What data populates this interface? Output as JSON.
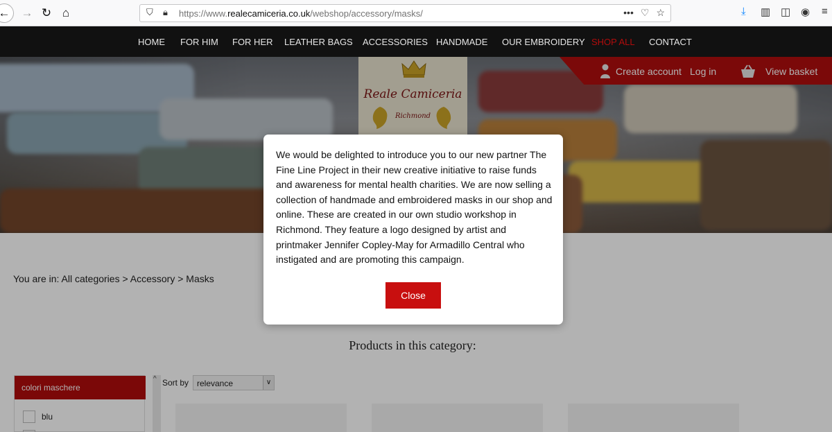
{
  "browser": {
    "url_prefix": "https://www.",
    "url_domain": "realecamiceria.co.uk",
    "url_path": "/webshop/accessory/masks/",
    "more_label": "•••"
  },
  "nav": {
    "items": [
      "HOME",
      "FOR HIM",
      "FOR HER",
      "LEATHER BAGS",
      "ACCESSORIES",
      "HANDMADE",
      "OUR EMBROIDERY",
      "SHOP ALL",
      "CONTACT"
    ],
    "active": "SHOP ALL",
    "active_color": "#b10c0c"
  },
  "brand": {
    "name": "Reale Camiceria",
    "location": "Richmond"
  },
  "account": {
    "create": "Create account",
    "login": "Log in",
    "basket": "View basket",
    "bar_color": "#b00e0e"
  },
  "breadcrumb": "You are in: All categories > Accessory > Masks",
  "products_heading": "Products in this category:",
  "filter": {
    "title": "colori maschere",
    "options": [
      "blu"
    ]
  },
  "sort": {
    "label": "Sort by",
    "value": "relevance"
  },
  "modal": {
    "text": "We would be delighted to introduce you to our new partner The Fine Line Project in their new creative initiative to raise funds and awareness for mental health charities. We are now selling a collection of handmade and embroidered masks in our shop and online. These are created in our own studio workshop in Richmond. They feature a logo designed by artist and printmaker Jennifer Copley-May for Armadillo Central who instigated and are promoting this campaign.",
    "close_label": "Close",
    "button_color": "#c80f0f"
  }
}
